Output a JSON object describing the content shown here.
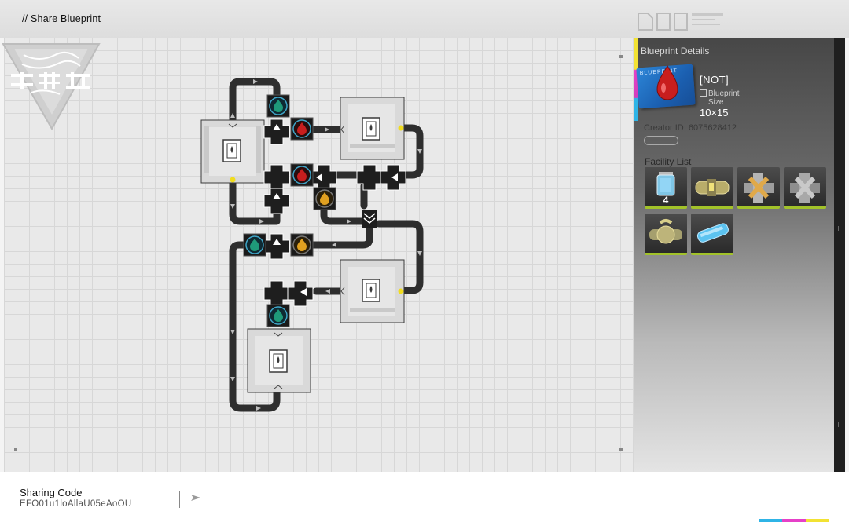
{
  "header": {
    "title": "// Share Blueprint"
  },
  "panel": {
    "title": "Blueprint Details",
    "blueprint_card_label": "BLUEPRINT",
    "blueprint_name": "[NOT]",
    "size_label": "Blueprint",
    "size_sublabel": "Size",
    "size_value": "10×15",
    "creator_id": "Creator ID: 6075628412",
    "facility_title": "Facility List",
    "facilities": [
      {
        "name": "canister-unit",
        "count": "4"
      },
      {
        "name": "pipe-straight",
        "count": ""
      },
      {
        "name": "pipe-cross-splitter",
        "count": ""
      },
      {
        "name": "pipe-cross-merger",
        "count": ""
      },
      {
        "name": "pipe-junction",
        "count": ""
      },
      {
        "name": "glass-tube",
        "count": ""
      }
    ]
  },
  "footer": {
    "sharing_label": "Sharing Code",
    "sharing_code": "EFO01u1loAllaU05eAoOU"
  },
  "colors": {
    "accent_yellow": "#f2e233",
    "accent_magenta": "#e640c8",
    "accent_cyan": "#2fb4e6",
    "facility_border": "#a2c229",
    "fluid_red": "#c81e1e",
    "fluid_green": "#1f9a7a",
    "fluid_amber": "#e0a020"
  }
}
